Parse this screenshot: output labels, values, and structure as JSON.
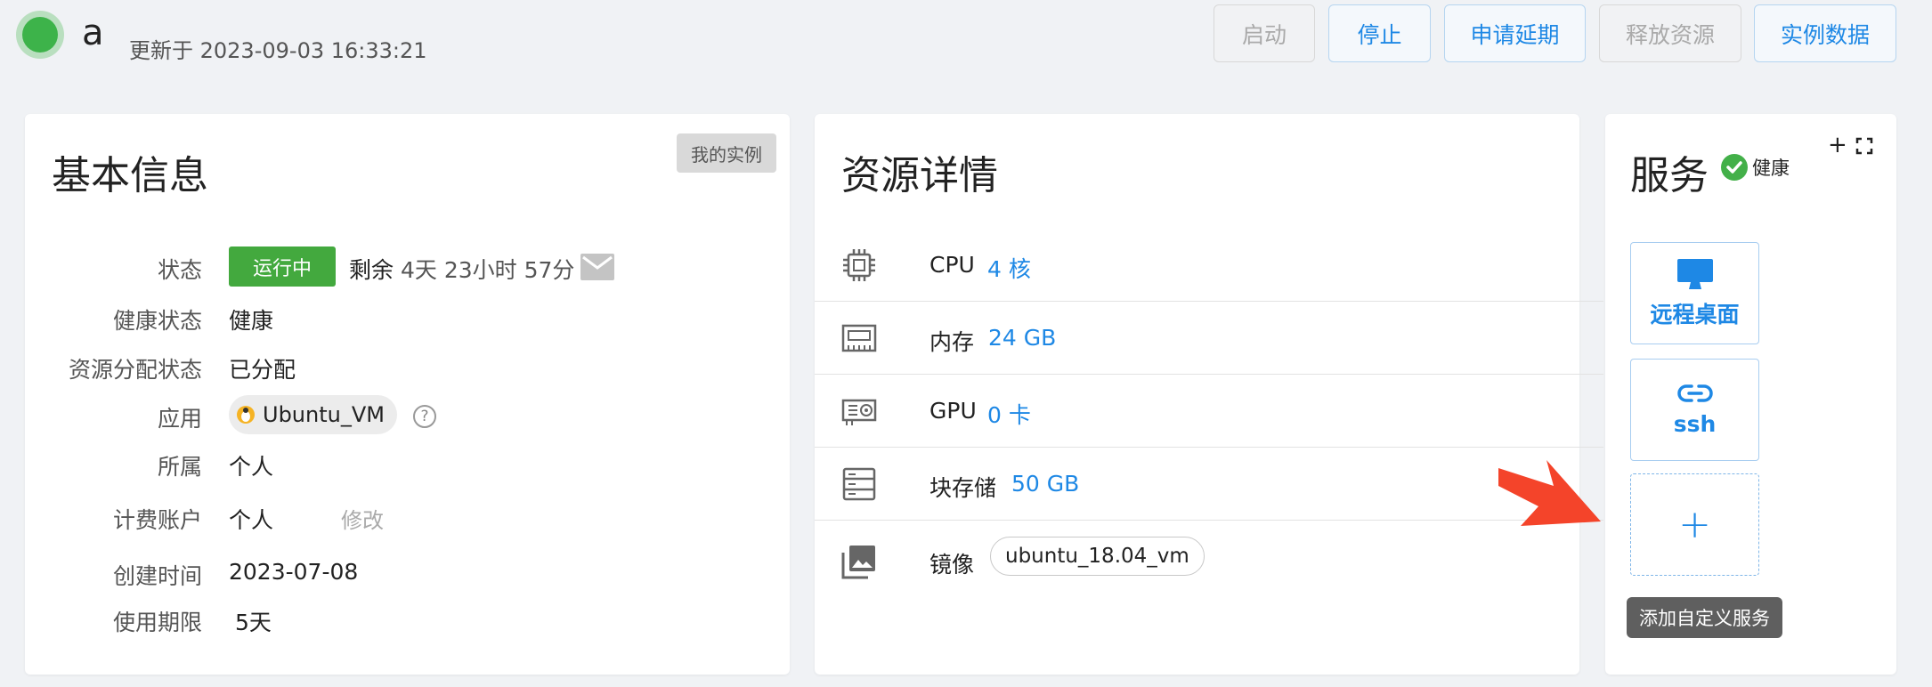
{
  "header": {
    "instance_name": "a",
    "updated_text": "更新于 2023-09-03 16:33:21",
    "buttons": {
      "start": "启动",
      "stop": "停止",
      "extend": "申请延期",
      "release": "释放资源",
      "instance_data": "实例数据"
    }
  },
  "basic_info": {
    "title": "基本信息",
    "my_instances_tag": "我的实例",
    "rows": {
      "status_label": "状态",
      "status_badge": "运行中",
      "remaining_label": "剩余",
      "remaining_value": "4天 23小时 57分",
      "health_label": "健康状态",
      "health_value": "健康",
      "alloc_label": "资源分配状态",
      "alloc_value": "已分配",
      "app_label": "应用",
      "app_value": "Ubuntu_VM",
      "owner_label": "所属",
      "owner_value": "个人",
      "billing_label": "计费账户",
      "billing_value": "个人",
      "modify_link": "修改",
      "created_label": "创建时间",
      "created_value": "2023-07-08",
      "term_label": "使用期限",
      "term_value": "5天"
    }
  },
  "resources": {
    "title": "资源详情",
    "cpu_label": "CPU",
    "cpu_value": "4 核",
    "mem_label": "内存",
    "mem_value": "24 GB",
    "gpu_label": "GPU",
    "gpu_value": "0 卡",
    "storage_label": "块存储",
    "storage_value": "50 GB",
    "image_label": "镜像",
    "image_value": "ubuntu_18.04_vm"
  },
  "services": {
    "title": "服务",
    "health": "健康",
    "add_icon": "+",
    "remote_desktop": "远程桌面",
    "ssh": "ssh",
    "add_button": "+",
    "add_tooltip": "添加自定义服务"
  },
  "colors": {
    "accent": "#1e88e5",
    "running": "#43a93e",
    "healthy": "#3db34a",
    "annotation_arrow": "#f4442a"
  }
}
